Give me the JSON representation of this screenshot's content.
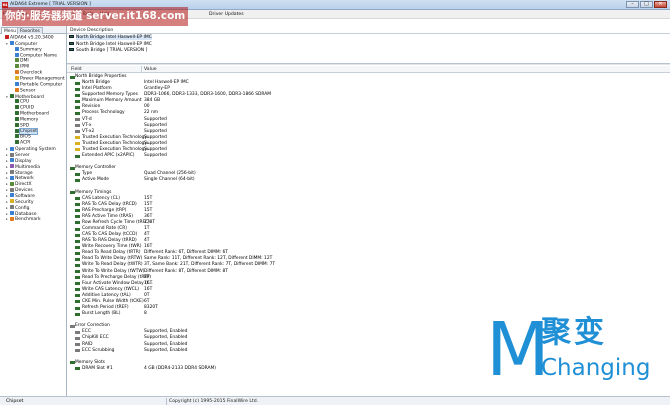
{
  "window": {
    "title": "AIDA64 Extreme  [ TRIAL VERSION ]",
    "app_icon_label": "64",
    "minimize": "–",
    "maximize": "□",
    "close": "✕"
  },
  "watermark": {
    "text": "你的·服务器频道 server.it168.com"
  },
  "menu": {
    "items": [
      "File",
      "View",
      "Report",
      "Favorites",
      "Tools",
      "Help"
    ],
    "extra": "Driver Updates"
  },
  "left_tabs": [
    "Menu",
    "Favorites"
  ],
  "tree": [
    {
      "label": "AIDA64 v5.20.3400",
      "icon": "aida64-icon",
      "color": "#c62020",
      "level": 0,
      "exp": ""
    },
    {
      "label": "Computer",
      "icon": "computer-icon",
      "color": "#3b7fd0",
      "level": 1,
      "exp": "▾"
    },
    {
      "label": "Summary",
      "icon": "summary-icon",
      "color": "#3b7fd0",
      "level": 2,
      "exp": ""
    },
    {
      "label": "Computer Name",
      "icon": "computer-name-icon",
      "color": "#3b7fd0",
      "level": 2,
      "exp": ""
    },
    {
      "label": "DMI",
      "icon": "dmi-icon",
      "color": "#5a8a3a",
      "level": 2,
      "exp": ""
    },
    {
      "label": "IPMI",
      "icon": "ipmi-icon",
      "color": "#5a8a3a",
      "level": 2,
      "exp": ""
    },
    {
      "label": "Overclock",
      "icon": "overclock-icon",
      "color": "#e07b20",
      "level": 2,
      "exp": ""
    },
    {
      "label": "Power Management",
      "icon": "power-icon",
      "color": "#d8b020",
      "level": 2,
      "exp": ""
    },
    {
      "label": "Portable Computer",
      "icon": "laptop-icon",
      "color": "#3b7fd0",
      "level": 2,
      "exp": ""
    },
    {
      "label": "Sensor",
      "icon": "sensor-icon",
      "color": "#e07b20",
      "level": 2,
      "exp": ""
    },
    {
      "label": "Motherboard",
      "icon": "motherboard-icon",
      "color": "#2f6e2f",
      "level": 1,
      "exp": "▾"
    },
    {
      "label": "CPU",
      "icon": "cpu-icon",
      "color": "#2f6e2f",
      "level": 2,
      "exp": ""
    },
    {
      "label": "CPUID",
      "icon": "cpuid-icon",
      "color": "#2f6e2f",
      "level": 2,
      "exp": ""
    },
    {
      "label": "Motherboard",
      "icon": "board-icon",
      "color": "#2f6e2f",
      "level": 2,
      "exp": ""
    },
    {
      "label": "Memory",
      "icon": "memory-icon",
      "color": "#2f6e2f",
      "level": 2,
      "exp": ""
    },
    {
      "label": "SPD",
      "icon": "spd-icon",
      "color": "#2f6e2f",
      "level": 2,
      "exp": ""
    },
    {
      "label": "Chipset",
      "icon": "chipset-icon",
      "color": "#2f6e2f",
      "level": 2,
      "exp": "",
      "selected": true
    },
    {
      "label": "BIOS",
      "icon": "bios-icon",
      "color": "#2f6e2f",
      "level": 2,
      "exp": ""
    },
    {
      "label": "ACPI",
      "icon": "acpi-icon",
      "color": "#2f6e2f",
      "level": 2,
      "exp": ""
    },
    {
      "label": "Operating System",
      "icon": "os-icon",
      "color": "#3b7fd0",
      "level": 1,
      "exp": "▸"
    },
    {
      "label": "Server",
      "icon": "server-icon",
      "color": "#7a7a7a",
      "level": 1,
      "exp": "▸"
    },
    {
      "label": "Display",
      "icon": "display-icon",
      "color": "#3b7fd0",
      "level": 1,
      "exp": "▸"
    },
    {
      "label": "Multimedia",
      "icon": "multimedia-icon",
      "color": "#8a5ab0",
      "level": 1,
      "exp": "▸"
    },
    {
      "label": "Storage",
      "icon": "storage-icon",
      "color": "#7a7a7a",
      "level": 1,
      "exp": "▸"
    },
    {
      "label": "Network",
      "icon": "network-icon",
      "color": "#3b7fd0",
      "level": 1,
      "exp": "▸"
    },
    {
      "label": "DirectX",
      "icon": "directx-icon",
      "color": "#5a8a3a",
      "level": 1,
      "exp": "▸"
    },
    {
      "label": "Devices",
      "icon": "devices-icon",
      "color": "#7a7a7a",
      "level": 1,
      "exp": "▸"
    },
    {
      "label": "Software",
      "icon": "software-icon",
      "color": "#3b7fd0",
      "level": 1,
      "exp": "▸"
    },
    {
      "label": "Security",
      "icon": "security-icon",
      "color": "#d8b020",
      "level": 1,
      "exp": "▸"
    },
    {
      "label": "Config",
      "icon": "config-icon",
      "color": "#7a7a7a",
      "level": 1,
      "exp": "▸"
    },
    {
      "label": "Database",
      "icon": "database-icon",
      "color": "#3b7fd0",
      "level": 1,
      "exp": "▸"
    },
    {
      "label": "Benchmark",
      "icon": "benchmark-icon",
      "color": "#e07b20",
      "level": 1,
      "exp": "▸"
    }
  ],
  "device_header": "Device Description",
  "devices": [
    {
      "label": "North Bridge Intel Haswell-EP IMC",
      "selected": true
    },
    {
      "label": "North Bridge Intel Haswell-EP IMC",
      "selected": false
    },
    {
      "label": "South Bridge  [ TRIAL VERSION ]",
      "selected": false
    }
  ],
  "columns": {
    "field": "Field",
    "value": "Value"
  },
  "rows": [
    {
      "type": "group",
      "field": "North Bridge Properties",
      "value": "",
      "y": 0,
      "icon": "nb-icon",
      "color": "#2f6e2f"
    },
    {
      "type": "item",
      "field": "North Bridge",
      "value": "Intel Haswell-EP IMC",
      "y": 1,
      "icon": "chip-icon",
      "color": "#2f6e2f"
    },
    {
      "type": "item",
      "field": "Intel Platform",
      "value": "Grantley-EP",
      "y": 2,
      "icon": "chip-icon",
      "color": "#2f6e2f"
    },
    {
      "type": "item",
      "field": "Supported Memory Types",
      "value": "DDR3-1066, DDR3-1333, DDR3-1600, DDR3-1866 SDRAM",
      "y": 3,
      "icon": "memory-icon",
      "color": "#2f6e2f"
    },
    {
      "type": "item",
      "field": "Maximum Memory Amount",
      "value": "384 GB",
      "y": 4,
      "icon": "memory-icon",
      "color": "#2f6e2f"
    },
    {
      "type": "item",
      "field": "Revision",
      "value": "00",
      "y": 5,
      "icon": "chip-icon",
      "color": "#2f6e2f"
    },
    {
      "type": "item",
      "field": "Process Technology",
      "value": "22 nm",
      "y": 6,
      "icon": "chip-icon",
      "color": "#2f6e2f"
    },
    {
      "type": "item",
      "field": "VT-d",
      "value": "Supported",
      "y": 7,
      "icon": "check-icon",
      "color": "#7a7a7a"
    },
    {
      "type": "item",
      "field": "VT-x",
      "value": "Supported",
      "y": 8,
      "icon": "check-icon",
      "color": "#7a7a7a"
    },
    {
      "type": "item",
      "field": "VT-x2",
      "value": "Supported",
      "y": 9,
      "icon": "check-icon",
      "color": "#7a7a7a"
    },
    {
      "type": "item",
      "field": "Trusted Execution Technology...",
      "value": "Supported",
      "y": 10,
      "icon": "lock-icon",
      "color": "#d8b020"
    },
    {
      "type": "item",
      "field": "Trusted Execution Technology...",
      "value": "Supported",
      "y": 11,
      "icon": "lock-icon",
      "color": "#d8b020"
    },
    {
      "type": "item",
      "field": "Trusted Execution Technology...",
      "value": "Supported",
      "y": 12,
      "icon": "lock-icon",
      "color": "#d8b020"
    },
    {
      "type": "item",
      "field": "Extended APIC (x2APIC)",
      "value": "Supported",
      "y": 13,
      "icon": "chip-icon",
      "color": "#2f6e2f"
    },
    {
      "type": "group",
      "field": "Memory Controller",
      "value": "",
      "y": 15,
      "icon": "memctrl-icon",
      "color": "#2f6e2f"
    },
    {
      "type": "item",
      "field": "Type",
      "value": "Quad Channel  (256-bit)",
      "y": 16,
      "icon": "memory-icon",
      "color": "#2f6e2f"
    },
    {
      "type": "item",
      "field": "Active Mode",
      "value": "Single Channel  (64-bit)",
      "y": 17,
      "icon": "memory-icon",
      "color": "#2f6e2f"
    },
    {
      "type": "group",
      "field": "Memory Timings",
      "value": "",
      "y": 19,
      "icon": "timings-icon",
      "color": "#2f6e2f"
    },
    {
      "type": "item",
      "field": "CAS Latency (CL)",
      "value": "15T",
      "y": 20,
      "icon": "memory-icon",
      "color": "#2f6e2f"
    },
    {
      "type": "item",
      "field": "RAS To CAS Delay (tRCD)",
      "value": "15T",
      "y": 21,
      "icon": "memory-icon",
      "color": "#2f6e2f"
    },
    {
      "type": "item",
      "field": "RAS Precharge (tRP)",
      "value": "15T",
      "y": 22,
      "icon": "memory-icon",
      "color": "#2f6e2f"
    },
    {
      "type": "item",
      "field": "RAS Active Time (tRAS)",
      "value": "36T",
      "y": 23,
      "icon": "memory-icon",
      "color": "#2f6e2f"
    },
    {
      "type": "item",
      "field": "Row Refresh Cycle Time (tRFC)",
      "value": "278T",
      "y": 24,
      "icon": "memory-icon",
      "color": "#2f6e2f"
    },
    {
      "type": "item",
      "field": "Command Rate (CR)",
      "value": "1T",
      "y": 25,
      "icon": "memory-icon",
      "color": "#2f6e2f"
    },
    {
      "type": "item",
      "field": "CAS To CAS Delay (tCCD)",
      "value": "4T",
      "y": 26,
      "icon": "memory-icon",
      "color": "#2f6e2f"
    },
    {
      "type": "item",
      "field": "RAS To RAS Delay (tRRD)",
      "value": "4T",
      "y": 27,
      "icon": "memory-icon",
      "color": "#2f6e2f"
    },
    {
      "type": "item",
      "field": "Write Recovery Time (tWR)",
      "value": "16T",
      "y": 28,
      "icon": "memory-icon",
      "color": "#2f6e2f"
    },
    {
      "type": "item",
      "field": "Read To Read Delay (tRTR)",
      "value": "Different Rank: 6T, Different DIMM: 6T",
      "y": 29,
      "icon": "memory-icon",
      "color": "#2f6e2f"
    },
    {
      "type": "item",
      "field": "Read To Write Delay (tRTW)",
      "value": "Same Rank: 11T, Different Rank: 12T, Different DIMM: 12T",
      "y": 30,
      "icon": "memory-icon",
      "color": "#2f6e2f"
    },
    {
      "type": "item",
      "field": "Write To Read Delay (tWTR)",
      "value": "3T, Same Bank: 21T, Different Rank: 7T, Different DIMM: 7T",
      "y": 31,
      "icon": "memory-icon",
      "color": "#2f6e2f"
    },
    {
      "type": "item",
      "field": "Write To Write Delay (tWTW)",
      "value": "Different Rank: 8T, Different DIMM: 8T",
      "y": 32,
      "icon": "memory-icon",
      "color": "#2f6e2f"
    },
    {
      "type": "item",
      "field": "Read To Precharge Delay (tRTP)",
      "value": "8T",
      "y": 33,
      "icon": "memory-icon",
      "color": "#2f6e2f"
    },
    {
      "type": "item",
      "field": "Four Activate Window Delay (t...",
      "value": "16T",
      "y": 34,
      "icon": "memory-icon",
      "color": "#2f6e2f"
    },
    {
      "type": "item",
      "field": "Write CAS Latency (tWCL)",
      "value": "16T",
      "y": 35,
      "icon": "memory-icon",
      "color": "#2f6e2f"
    },
    {
      "type": "item",
      "field": "Additive Latency (tAL)",
      "value": "0T",
      "y": 36,
      "icon": "memory-icon",
      "color": "#2f6e2f"
    },
    {
      "type": "item",
      "field": "CKE Min. Pulse Width (tCKE)",
      "value": "6T",
      "y": 37,
      "icon": "memory-icon",
      "color": "#2f6e2f"
    },
    {
      "type": "item",
      "field": "Refresh Period (tREF)",
      "value": "8320T",
      "y": 38,
      "icon": "memory-icon",
      "color": "#2f6e2f"
    },
    {
      "type": "item",
      "field": "Burst Length (BL)",
      "value": "8",
      "y": 39,
      "icon": "memory-icon",
      "color": "#2f6e2f"
    },
    {
      "type": "group",
      "field": "Error Correction",
      "value": "",
      "y": 41,
      "icon": "error-icon",
      "color": "#7a7a7a"
    },
    {
      "type": "item",
      "field": "ECC",
      "value": "Supported, Enabled",
      "y": 42,
      "icon": "check-icon",
      "color": "#7a7a7a"
    },
    {
      "type": "item",
      "field": "ChipKill ECC",
      "value": "Supported, Enabled",
      "y": 43,
      "icon": "check-icon",
      "color": "#7a7a7a"
    },
    {
      "type": "item",
      "field": "RAID",
      "value": "Supported, Enabled",
      "y": 44,
      "icon": "check-icon",
      "color": "#7a7a7a"
    },
    {
      "type": "item",
      "field": "ECC Scrubbing",
      "value": "Supported, Enabled",
      "y": 45,
      "icon": "check-icon",
      "color": "#7a7a7a"
    },
    {
      "type": "group",
      "field": "Memory Slots",
      "value": "",
      "y": 47,
      "icon": "slots-icon",
      "color": "#2f6e2f"
    },
    {
      "type": "item",
      "field": "DRAM Slot #1",
      "value": "4 GB  (DDR4-2133 DDR4 SDRAM)",
      "y": 48,
      "icon": "memory-icon",
      "color": "#2f6e2f"
    }
  ],
  "status": {
    "left": "Chipset",
    "right": "Copyright (c) 1995-2015 FinalWire Ltd."
  },
  "logo": {
    "letter": "M",
    "cn": "聚变",
    "en": "Changing",
    "color": "#1f8fd6"
  }
}
